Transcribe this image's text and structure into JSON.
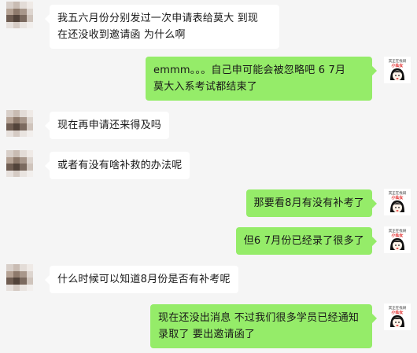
{
  "colors": {
    "background": "#f5f5f5",
    "incoming_bubble": "#ffffff",
    "outgoing_bubble": "#95ec69",
    "text": "#191919"
  },
  "my_avatar": {
    "top_label": "其正在找研",
    "name_label": "小仙女"
  },
  "messages": [
    {
      "side": "in",
      "text": "我五六月份分别发过一次申请表给莫大 到现\n在还没收到邀请函 为什么啊"
    },
    {
      "side": "out",
      "text": "emmm。。。自己申可能会被忽略吧 6 7月\n莫大入系考试都结束了"
    },
    {
      "side": "in",
      "text": "现在再申请还来得及吗"
    },
    {
      "side": "in",
      "text": "或者有没有啥补救的办法呢"
    },
    {
      "side": "out",
      "text": "那要看8月有没有补考了"
    },
    {
      "side": "out",
      "text": "但6 7月份已经录了很多了"
    },
    {
      "side": "in",
      "text": "什么时候可以知道8月份是否有补考呢"
    },
    {
      "side": "out",
      "text": "现在还没出消息 不过我们很多学员已经通知\n录取了 要出邀请函了"
    }
  ]
}
